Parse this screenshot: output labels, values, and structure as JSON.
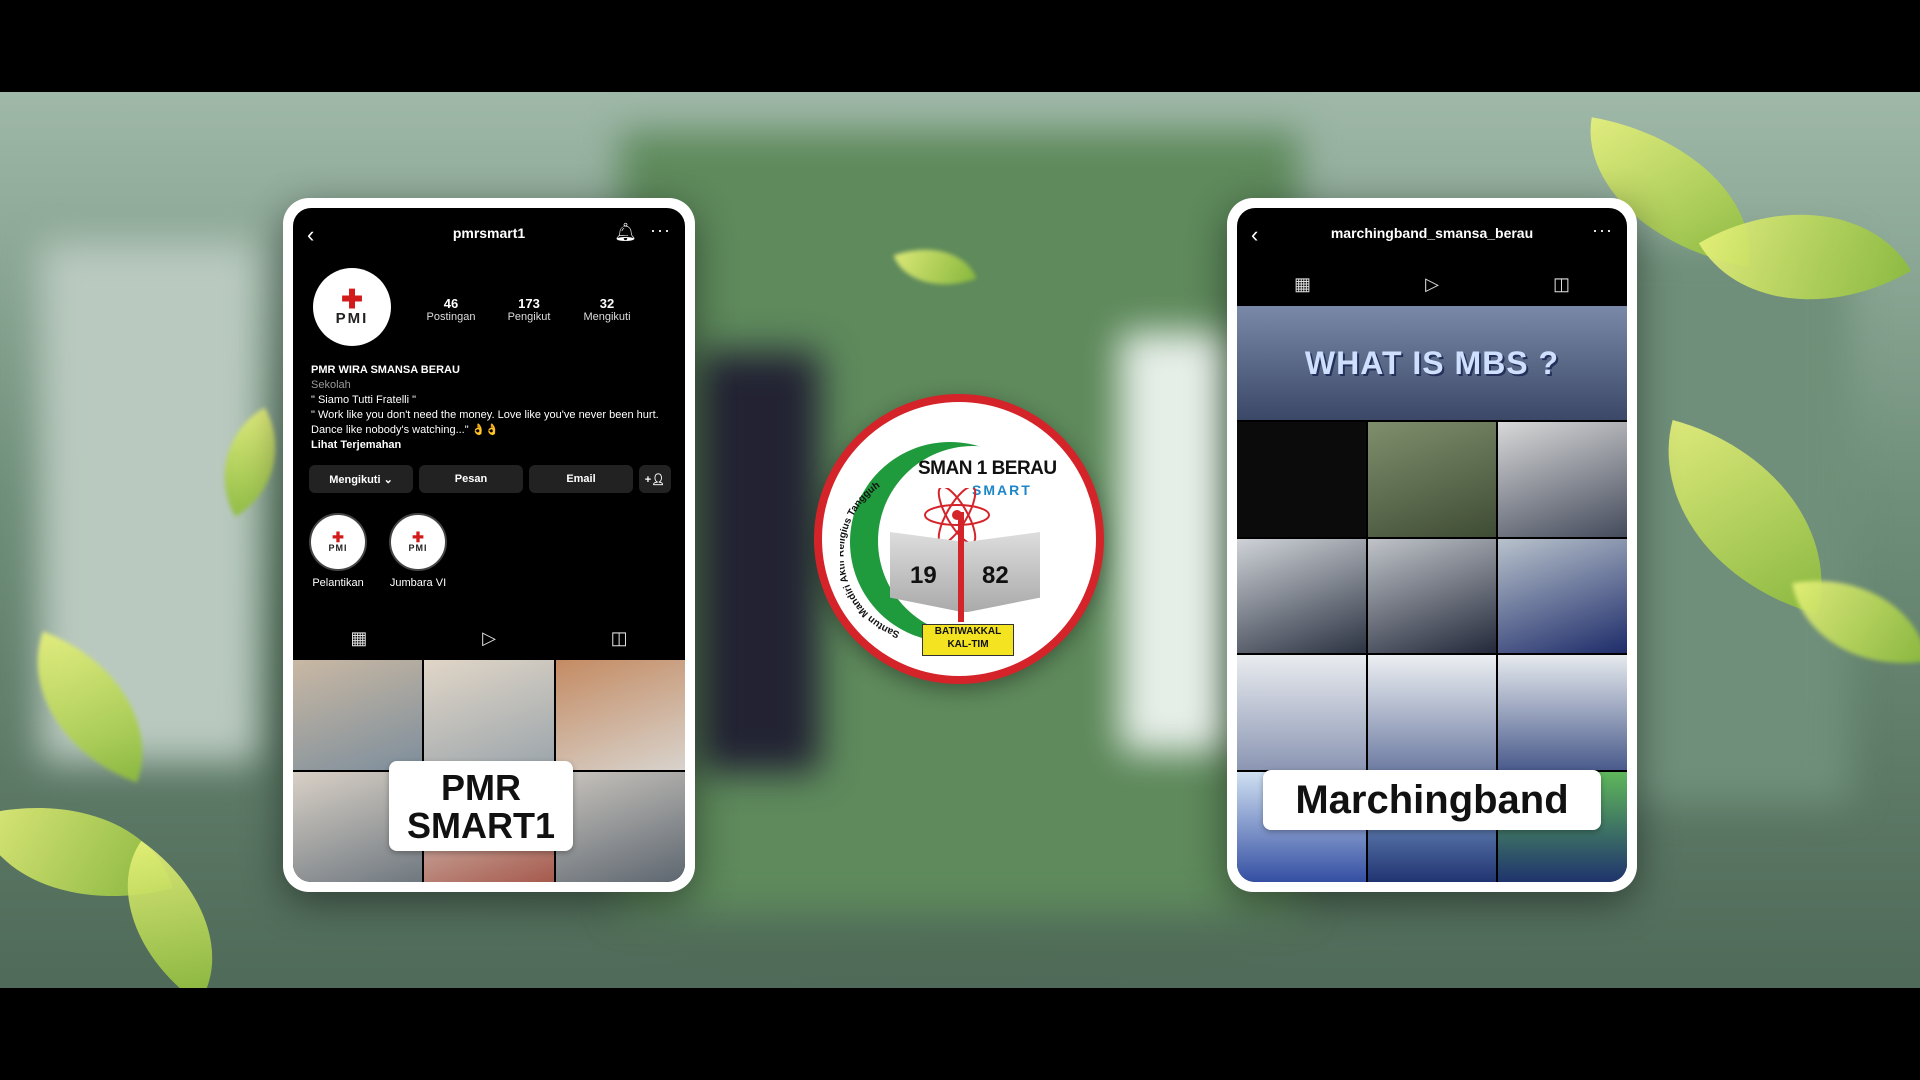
{
  "pmr_profile": {
    "username": "pmrsmart1",
    "avatar_text": "PMI",
    "stats": [
      {
        "num": "46",
        "label": "Postingan"
      },
      {
        "num": "173",
        "label": "Pengikut"
      },
      {
        "num": "32",
        "label": "Mengikuti"
      }
    ],
    "bio": {
      "name": "PMR WIRA SMANSA BERAU",
      "category": "Sekolah",
      "line1": "\" Siamo Tutti Fratelli \"",
      "line2": "\" Work like you don't need the money. Love like you've never been hurt. Dance like nobody's watching...\" 👌👌",
      "translate": "Lihat Terjemahan"
    },
    "buttons": {
      "following": "Mengikuti ⌄",
      "message": "Pesan",
      "email": "Email"
    },
    "highlights": [
      {
        "label": "Pelantikan",
        "icon_text": "PMI"
      },
      {
        "label": "Jumbara VI",
        "icon_text": "PMI"
      }
    ],
    "overlay_label_line1": "PMR",
    "overlay_label_line2": "SMART1"
  },
  "marching_profile": {
    "username": "marchingband_smansa_berau",
    "first_post_text": "WHAT IS MBS ?",
    "overlay_label": "Marchingband"
  },
  "logo": {
    "title": "SMAN 1 BERAU",
    "subtitle": "SMART",
    "year_left": "19",
    "year_right": "82",
    "motto": "Santun Mandiri Aktif Religius Tangguh",
    "ribbon_line1": "BATIWAKKAL",
    "ribbon_line2": "KAL-TIM"
  },
  "icons": {
    "back": "chevron-left-icon",
    "bell": "bell-icon",
    "more": "more-icon",
    "grid": "grid-icon",
    "reels": "play-icon",
    "tagged": "tagged-icon",
    "add_user": "add-user-icon"
  },
  "colors": {
    "pmi_red": "#d21c1c",
    "logo_green": "#1f9a3c",
    "logo_blue": "#1c86c8",
    "ribbon_yellow": "#f3e321"
  }
}
